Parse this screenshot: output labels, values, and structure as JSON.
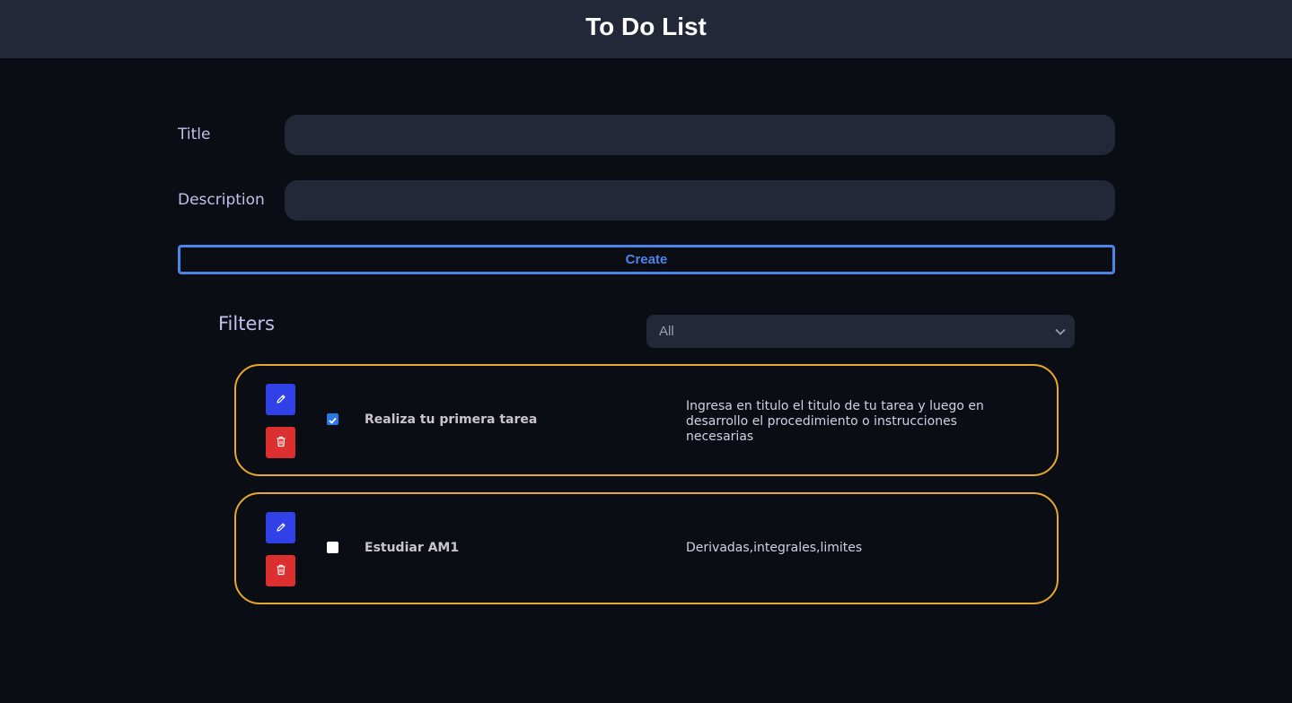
{
  "header": {
    "title": "To Do List"
  },
  "form": {
    "title_label": "Title",
    "title_value": "",
    "description_label": "Description",
    "description_value": "",
    "create_label": "Create"
  },
  "filters": {
    "label": "Filters",
    "selected": "All"
  },
  "tasks": [
    {
      "title": "Realiza tu primera tarea",
      "description": "Ingresa en titulo el titulo de tu tarea y luego en desarrollo el procedimiento o instrucciones necesarias",
      "completed": true
    },
    {
      "title": "Estudiar AM1",
      "description": "Derivadas,integrales,limites",
      "completed": false
    }
  ],
  "colors": {
    "header_bg": "#232838",
    "page_bg": "#0a0d14",
    "accent_blue": "#4a86e8",
    "task_border": "#e8a82c",
    "edit_button": "#3041e8",
    "delete_button": "#dc2f2f"
  },
  "icons": {
    "edit": "pencil-icon",
    "delete": "trash-icon",
    "select": "chevron-down-icon"
  }
}
